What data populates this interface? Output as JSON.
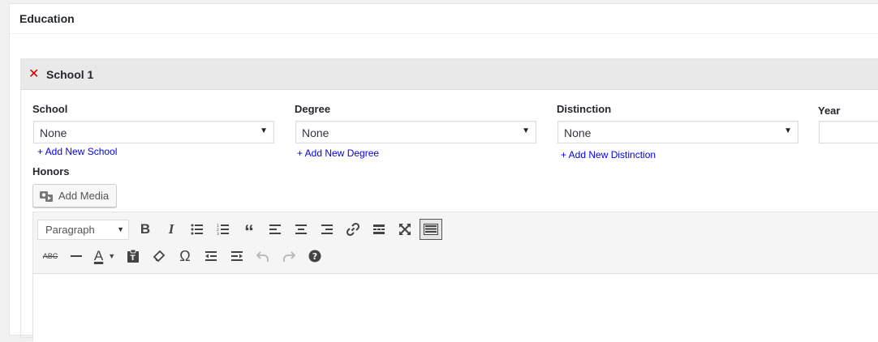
{
  "panel": {
    "title": "Education"
  },
  "group": {
    "remove_icon": "close-icon",
    "title": "School 1"
  },
  "fields": {
    "school": {
      "label": "School",
      "value": "None",
      "add_link": "+ Add New School"
    },
    "degree": {
      "label": "Degree",
      "value": "None",
      "add_link": "+ Add New Degree"
    },
    "distinction": {
      "label": "Distinction",
      "value": "None",
      "add_link": "+ Add New Distinction"
    },
    "year": {
      "label": "Year",
      "value": ""
    },
    "honors": {
      "label": "Honors"
    }
  },
  "editor": {
    "add_media_label": "Add Media",
    "format_select": "Paragraph",
    "row1_icons": [
      "bold-icon",
      "italic-icon",
      "bullet-list-icon",
      "numbered-list-icon",
      "blockquote-icon",
      "align-left-icon",
      "align-center-icon",
      "align-right-icon",
      "link-icon",
      "read-more-icon",
      "fullscreen-icon",
      "toolbar-toggle-icon"
    ],
    "row2_icons": [
      "strikethrough-icon",
      "horizontal-line-icon",
      "text-color-icon",
      "paste-text-icon",
      "clear-formatting-icon",
      "special-character-icon",
      "outdent-icon",
      "indent-icon",
      "undo-icon",
      "redo-icon",
      "help-icon"
    ]
  },
  "colors": {
    "remove": "#cc0000",
    "link": "#0000ee",
    "header_bg": "#e9e9e9"
  }
}
